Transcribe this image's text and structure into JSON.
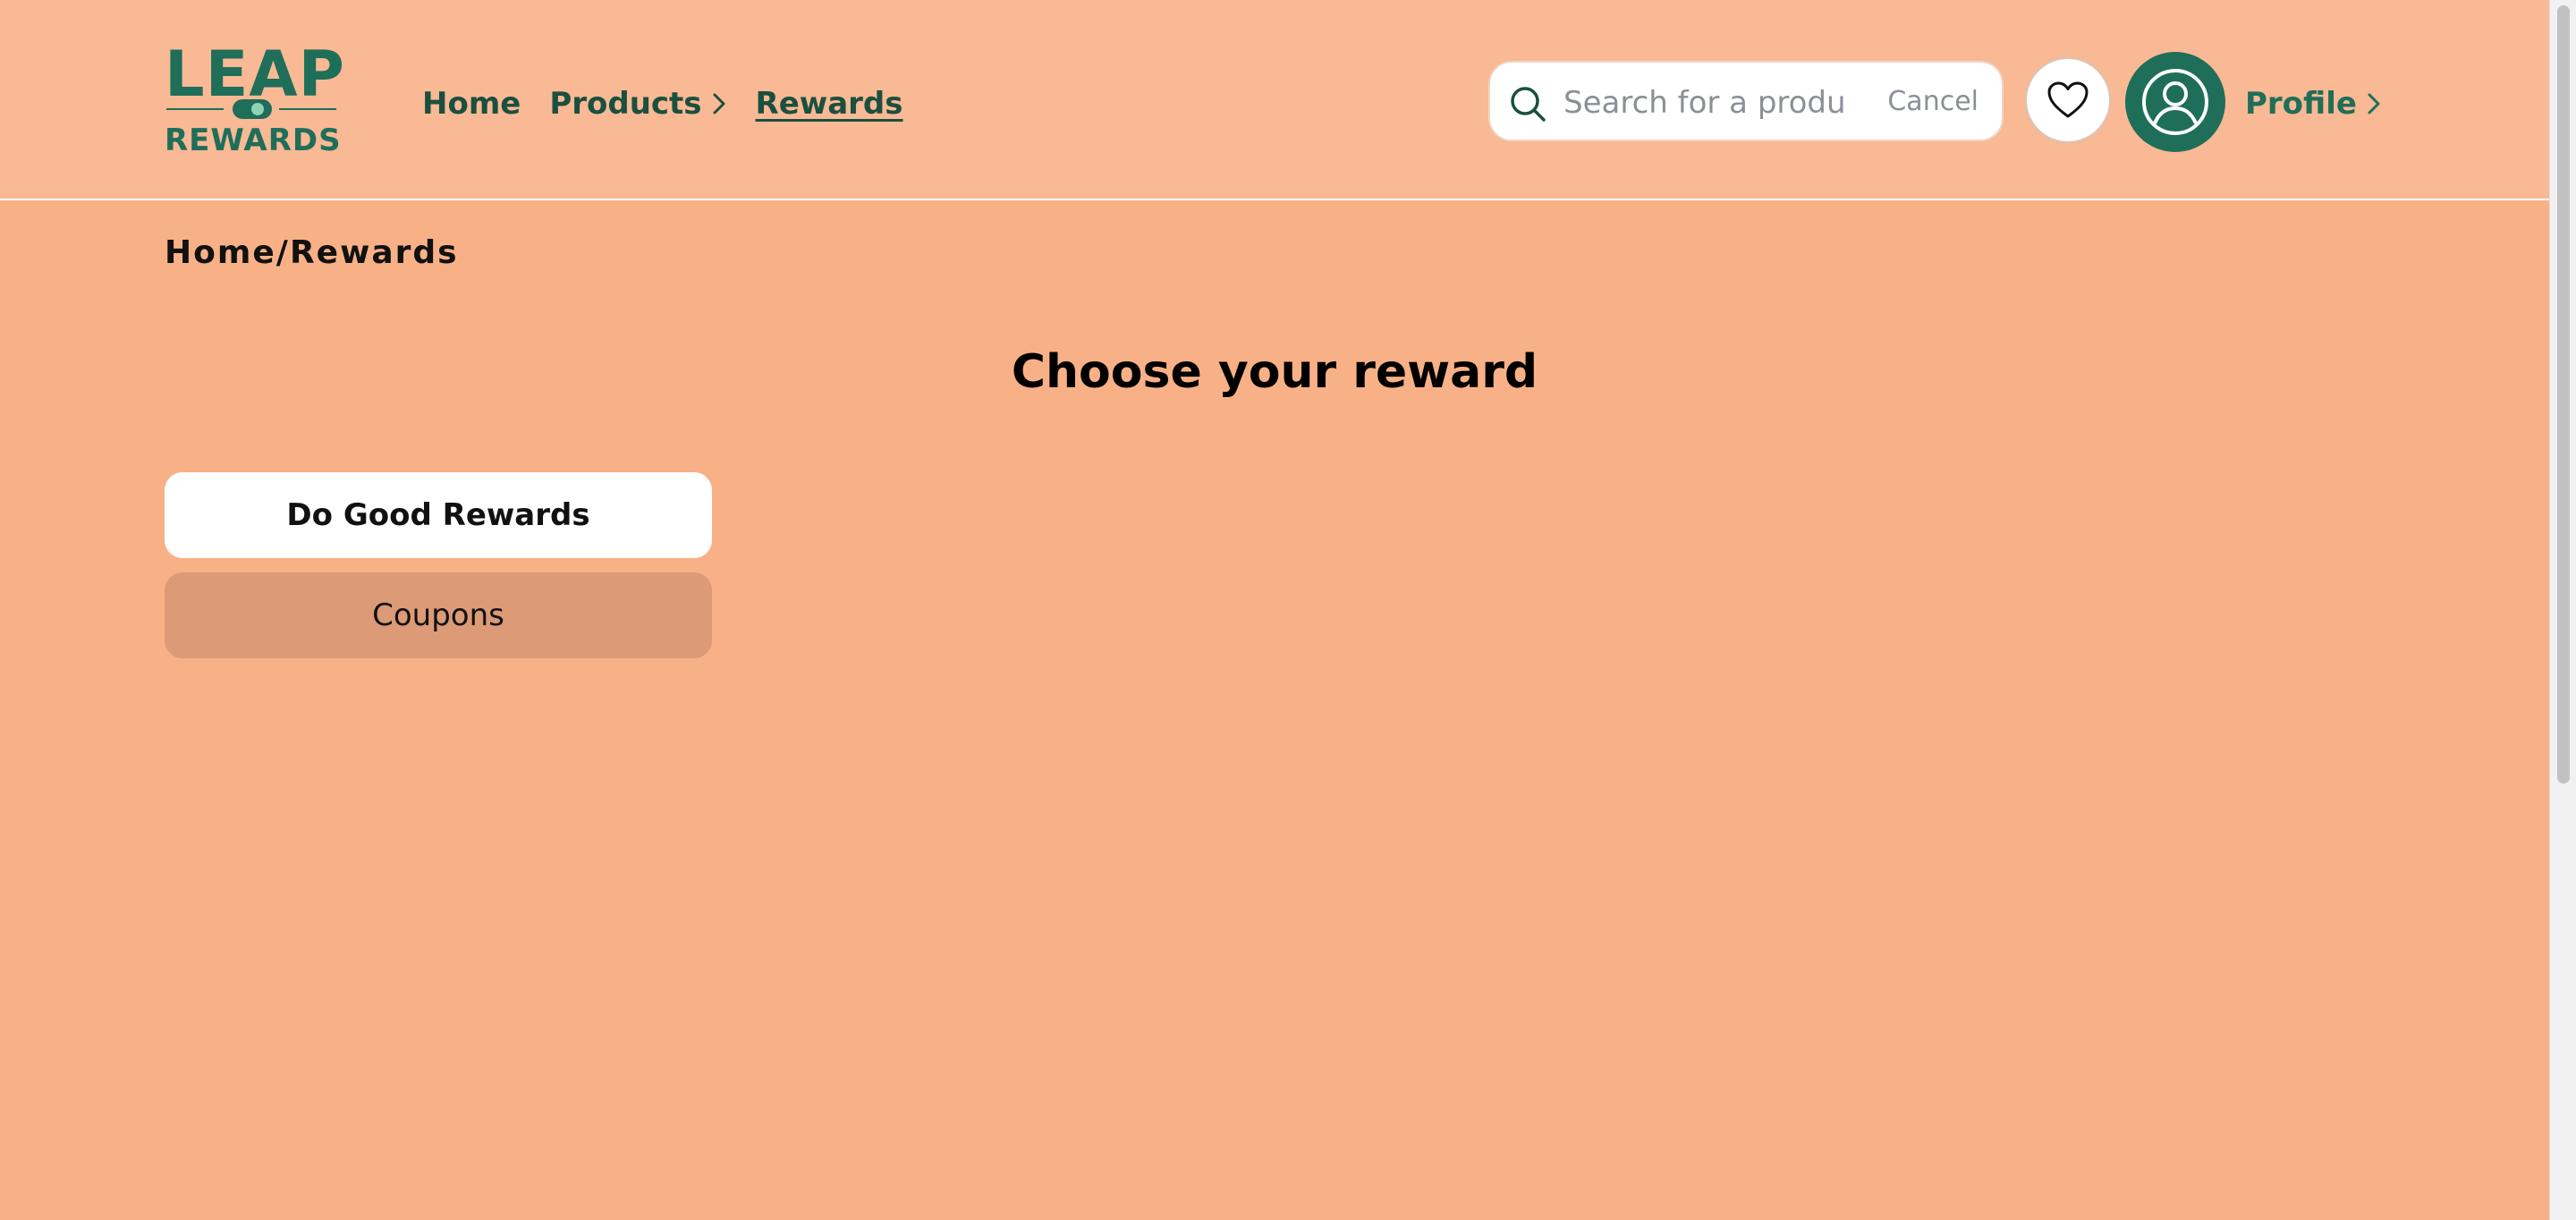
{
  "brand": {
    "logo_top": "LEAP",
    "logo_bottom": "REWARDS",
    "color": "#1f6e5a"
  },
  "nav": {
    "home": "Home",
    "products": "Products",
    "rewards": "Rewards",
    "active": "Rewards"
  },
  "search": {
    "placeholder": "Search for a product",
    "value": "",
    "cancel_label": "Cancel",
    "icon": "search-icon"
  },
  "header_actions": {
    "favorites_icon": "heart-icon",
    "avatar_icon": "user-icon",
    "profile_label": "Profile"
  },
  "breadcrumb": "Home/Rewards",
  "page_title": "Choose your reward",
  "reward_tabs": [
    {
      "label": "Do Good Rewards",
      "selected": true
    },
    {
      "label": "Coupons",
      "selected": false
    }
  ],
  "colors": {
    "header_bg": "#f8b994",
    "page_bg": "#f8b187",
    "accent": "#1f6e5a",
    "tab_selected": "#ffffff",
    "tab_unselected": "#dc9a76"
  }
}
